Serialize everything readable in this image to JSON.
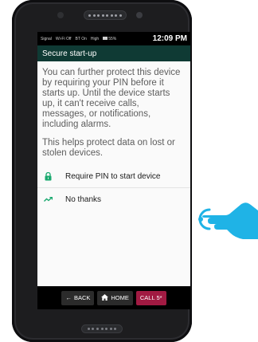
{
  "status_bar": {
    "signal": "Signal",
    "wifi": "Wi-Fi Off",
    "bluetooth": "BT On",
    "volume": "High",
    "battery": "55%",
    "time": "12:09 PM"
  },
  "header": {
    "title": "Secure start-up"
  },
  "main": {
    "paragraph1": "You can further protect this device by requiring your PIN before it starts up. Until the device starts up, it can't receive calls, messages, or notifications, including alarms.",
    "paragraph2": "This helps protect data on lost or stolen devices."
  },
  "options": [
    {
      "label": "Require PIN to start device",
      "icon": "lock-icon"
    },
    {
      "label": "No thanks",
      "icon": "trend-arrow-icon"
    }
  ],
  "navbar": {
    "back": "BACK",
    "home": "HOME",
    "call": "CALL 5*"
  },
  "colors": {
    "title_bar": "#0f3a34",
    "accent": "#1aa96f",
    "call_button": "#a11a42",
    "pointer_hand": "#1fb3e6"
  }
}
